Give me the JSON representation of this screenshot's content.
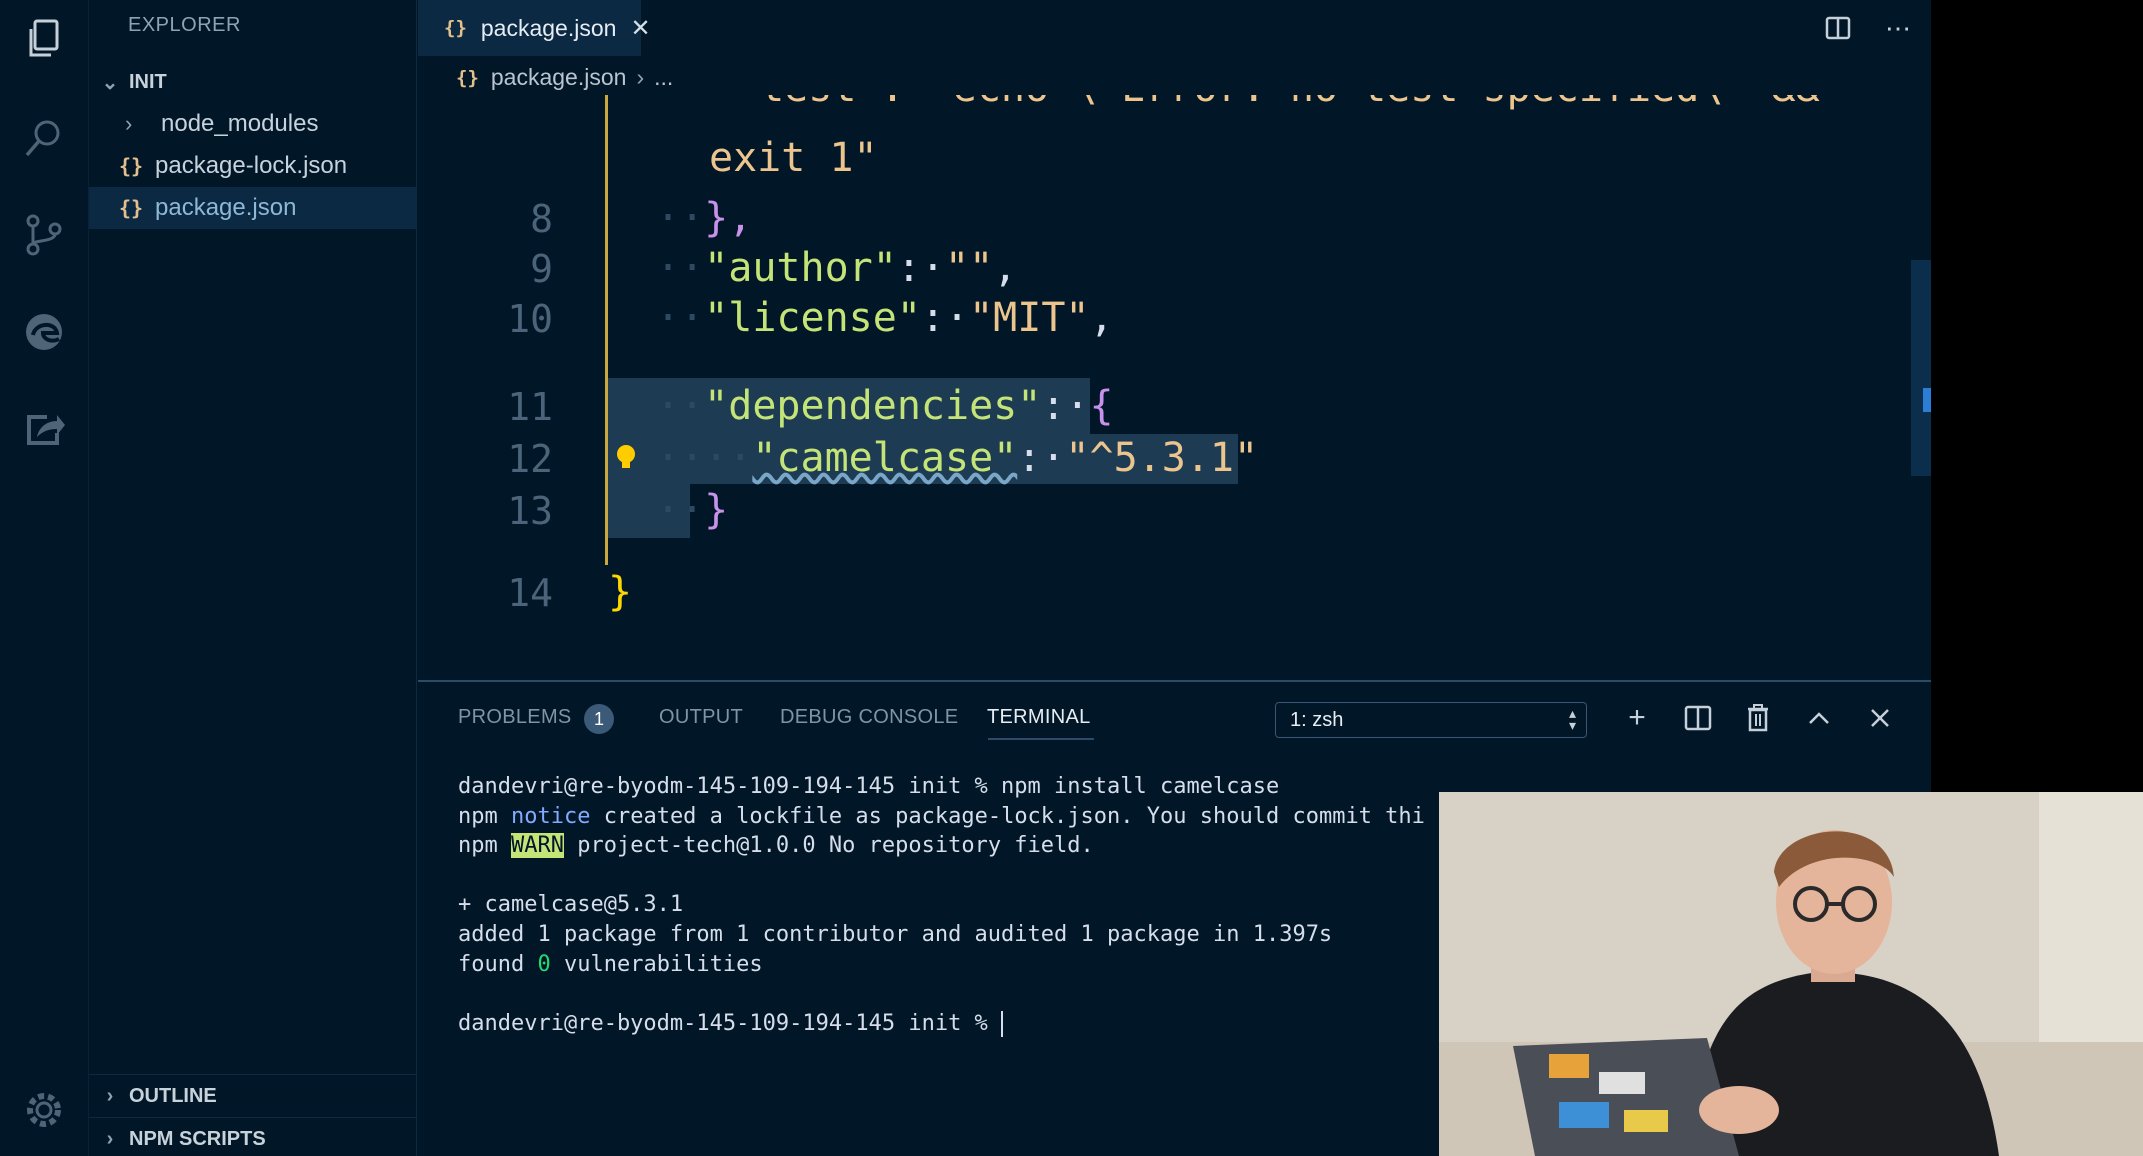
{
  "sidebar": {
    "title": "EXPLORER",
    "root": "INIT",
    "items": [
      {
        "label": "node_modules",
        "type": "folder"
      },
      {
        "label": "package-lock.json",
        "type": "json"
      },
      {
        "label": "package.json",
        "type": "json",
        "active": true
      }
    ],
    "json_icon": "{}",
    "outline": "OUTLINE",
    "npm_scripts": "NPM SCRIPTS"
  },
  "tab": {
    "icon": "{}",
    "label": "package.json",
    "close": "✕"
  },
  "breadcrumb": {
    "file": "package.json",
    "more": "..."
  },
  "editor": {
    "lines": [
      {
        "num": "",
        "text": "\"test\": \"echo \\\"Error: no test specified\\\" &&"
      },
      {
        "num": "",
        "text": "exit 1\""
      },
      {
        "num": "8",
        "text": "},"
      },
      {
        "num": "9",
        "key": "\"author\"",
        "value": "\"\""
      },
      {
        "num": "10",
        "key": "\"license\"",
        "value": "\"MIT\""
      },
      {
        "num": "11",
        "key": "\"dependencies\"",
        "brace": "{"
      },
      {
        "num": "12",
        "key": "\"camelcase\"",
        "value": "\"^5.3.1\""
      },
      {
        "num": "13",
        "text": "}"
      },
      {
        "num": "14",
        "text": "}"
      }
    ]
  },
  "panel": {
    "tabs": {
      "problems": "PROBLEMS",
      "output": "OUTPUT",
      "debug": "DEBUG CONSOLE",
      "terminal": "TERMINAL"
    },
    "problems_count": "1",
    "shell": "1: zsh"
  },
  "terminal": {
    "line1": "dandevri@re-byodm-145-109-194-145 init % npm install camelcase",
    "line2_a": "npm ",
    "line2_b": "notice",
    "line2_c": " created a lockfile as package-lock.json. You should commit thi",
    "line3_a": "npm ",
    "line3_b": "WARN",
    "line3_c": " project-tech@1.0.0 No repository field.",
    "line4": "+ camelcase@5.3.1",
    "line5": "added 1 package from 1 contributor and audited 1 package in 1.397s",
    "line6_a": "found ",
    "line6_b": "0",
    "line6_c": " vulnerabilities",
    "line7": "dandevri@re-byodm-145-109-194-145 init % "
  },
  "colors": {
    "background": "#011627",
    "sidebar_active": "#0b2942",
    "selection": "#1d3b53",
    "key": "#c5e478",
    "string": "#ecc48d",
    "brace": "#c792ea"
  }
}
